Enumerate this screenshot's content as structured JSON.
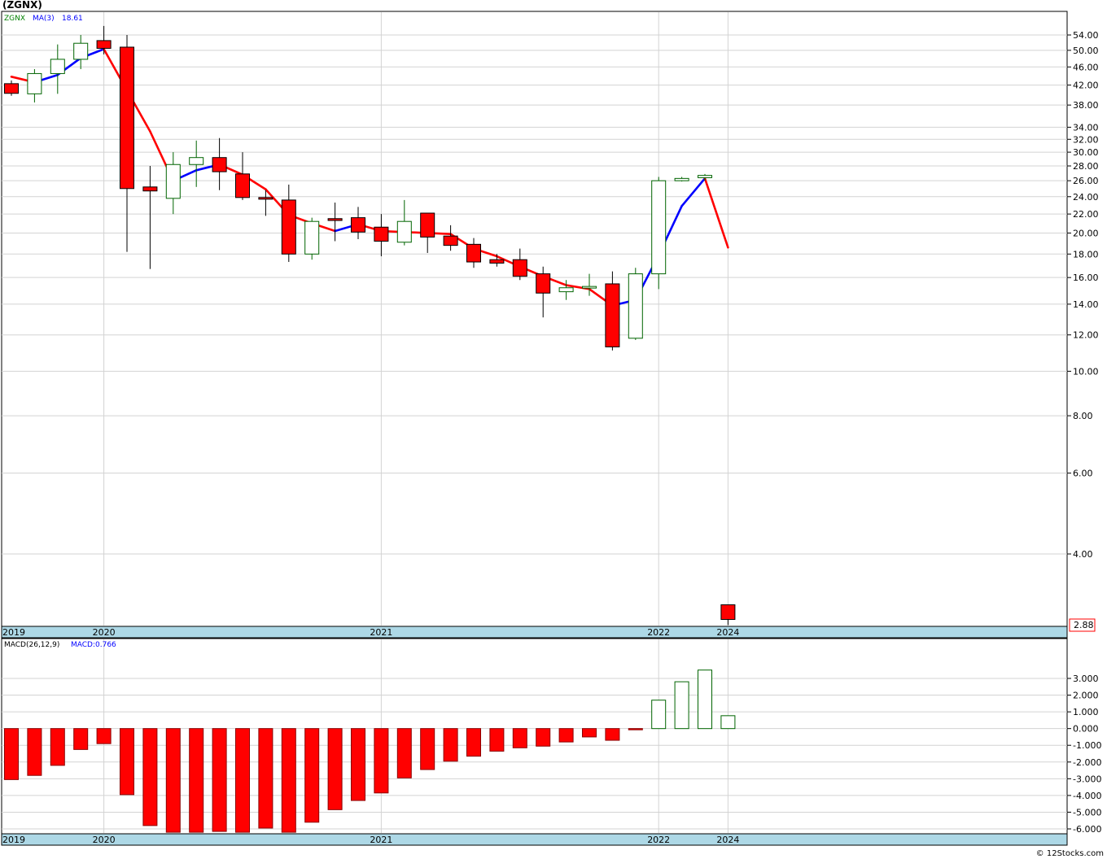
{
  "chart_data": [
    {
      "type": "candlestick",
      "title": "(ZGNX)",
      "legend": [
        {
          "text": "ZGNX",
          "color": "#008000"
        },
        {
          "text": "MA(3)",
          "color": "#0000ff"
        },
        {
          "text": "18.61",
          "color": "#0000ff"
        }
      ],
      "y_scale": "log",
      "y_ticks": [
        "54.00",
        "50.00",
        "46.00",
        "42.00",
        "38.00",
        "34.00",
        "32.00",
        "30.00",
        "28.00",
        "26.00",
        "24.00",
        "22.00",
        "20.00",
        "18.00",
        "16.00",
        "14.00",
        "12.00",
        "10.00",
        "8.00",
        "6.00",
        "4.00"
      ],
      "last_price": "2.88",
      "x_labels": [
        {
          "text": "2019",
          "index": -0.3
        },
        {
          "text": "2020",
          "index": 4
        },
        {
          "text": "2021",
          "index": 16
        },
        {
          "text": "2022",
          "index": 28
        },
        {
          "text": "2024",
          "index": 31
        }
      ],
      "candles": [
        {
          "o": 42.3,
          "h": 43.0,
          "l": 39.8,
          "c": 40.3
        },
        {
          "o": 40.2,
          "h": 45.5,
          "l": 38.5,
          "c": 44.5
        },
        {
          "o": 44.5,
          "h": 51.5,
          "l": 40.2,
          "c": 47.8
        },
        {
          "o": 47.8,
          "h": 54.0,
          "l": 45.5,
          "c": 51.8
        },
        {
          "o": 52.5,
          "h": 56.5,
          "l": 49.0,
          "c": 50.5
        },
        {
          "o": 50.8,
          "h": 54.0,
          "l": 18.2,
          "c": 25.0
        },
        {
          "o": 25.2,
          "h": 28.0,
          "l": 16.7,
          "c": 24.7
        },
        {
          "o": 23.8,
          "h": 30.0,
          "l": 22.0,
          "c": 28.2
        },
        {
          "o": 28.2,
          "h": 31.8,
          "l": 25.2,
          "c": 29.2
        },
        {
          "o": 29.2,
          "h": 32.2,
          "l": 24.8,
          "c": 27.2
        },
        {
          "o": 26.9,
          "h": 30.0,
          "l": 23.6,
          "c": 23.9
        },
        {
          "o": 23.9,
          "h": 24.8,
          "l": 21.8,
          "c": 23.7
        },
        {
          "o": 23.6,
          "h": 25.5,
          "l": 17.3,
          "c": 18.0
        },
        {
          "o": 18.0,
          "h": 21.6,
          "l": 17.5,
          "c": 21.2
        },
        {
          "o": 21.5,
          "h": 23.3,
          "l": 19.2,
          "c": 21.3
        },
        {
          "o": 21.6,
          "h": 22.8,
          "l": 19.4,
          "c": 20.1
        },
        {
          "o": 20.6,
          "h": 22.0,
          "l": 17.8,
          "c": 19.2
        },
        {
          "o": 19.1,
          "h": 23.6,
          "l": 18.8,
          "c": 21.2
        },
        {
          "o": 22.1,
          "h": 22.1,
          "l": 18.1,
          "c": 19.6
        },
        {
          "o": 19.7,
          "h": 20.8,
          "l": 18.3,
          "c": 18.8
        },
        {
          "o": 18.9,
          "h": 19.5,
          "l": 16.8,
          "c": 17.3
        },
        {
          "o": 17.5,
          "h": 18.0,
          "l": 16.9,
          "c": 17.2
        },
        {
          "o": 17.5,
          "h": 18.5,
          "l": 15.8,
          "c": 16.1
        },
        {
          "o": 16.3,
          "h": 16.9,
          "l": 13.1,
          "c": 14.8
        },
        {
          "o": 14.9,
          "h": 15.8,
          "l": 14.3,
          "c": 15.2
        },
        {
          "o": 15.2,
          "h": 16.3,
          "l": 14.6,
          "c": 15.3
        },
        {
          "o": 15.5,
          "h": 16.5,
          "l": 11.1,
          "c": 11.3
        },
        {
          "o": 11.8,
          "h": 16.8,
          "l": 11.7,
          "c": 16.3
        },
        {
          "o": 16.3,
          "h": 26.5,
          "l": 15.1,
          "c": 26.0
        },
        {
          "o": 26.0,
          "h": 26.5,
          "l": 25.9,
          "c": 26.3
        },
        {
          "o": 26.4,
          "h": 26.9,
          "l": 26.0,
          "c": 26.7
        },
        {
          "o": 3.1,
          "h": 3.1,
          "l": 2.8,
          "c": 2.88
        }
      ],
      "ma3": [
        43.8,
        42.6,
        44.2,
        48.1,
        50.3,
        40.9,
        33.3,
        26.0,
        27.4,
        28.2,
        26.8,
        24.9,
        21.9,
        21.0,
        20.2,
        20.9,
        20.2,
        20.1,
        20.0,
        19.9,
        18.5,
        17.8,
        16.9,
        16.1,
        15.4,
        15.1,
        13.9,
        14.3,
        17.9,
        22.9,
        26.3,
        18.6
      ],
      "ma3_colors": [
        "#ff0000",
        "#ff0000",
        "#0000ff",
        "#0000ff",
        "#0000ff",
        "#ff0000",
        "#ff0000",
        "#ff0000",
        "#0000ff",
        "#0000ff",
        "#ff0000",
        "#ff0000",
        "#ff0000",
        "#ff0000",
        "#ff0000",
        "#0000ff",
        "#ff0000",
        "#ff0000",
        "#ff0000",
        "#ff0000",
        "#ff0000",
        "#ff0000",
        "#ff0000",
        "#ff0000",
        "#ff0000",
        "#ff0000",
        "#ff0000",
        "#0000ff",
        "#0000ff",
        "#0000ff",
        "#0000ff",
        "#ff0000"
      ]
    },
    {
      "type": "bar",
      "title": "MACD(26,12,9)",
      "legend": [
        {
          "text": "MACD(26,12,9)",
          "color": "#000000"
        },
        {
          "text": "MACD:0.766",
          "color": "#0000ff"
        }
      ],
      "y_ticks": [
        "3.000",
        "2.000",
        "1.000",
        "0.000",
        "-1.000",
        "-2.000",
        "-3.000",
        "-4.000",
        "-5.000",
        "-6.000"
      ],
      "ylim": [
        -6.2,
        3.6
      ],
      "values": [
        -3.05,
        -2.8,
        -2.2,
        -1.25,
        -0.9,
        -3.95,
        -5.8,
        -6.25,
        -6.2,
        -6.15,
        -6.2,
        -5.95,
        -6.2,
        -5.6,
        -4.85,
        -4.3,
        -3.85,
        -2.95,
        -2.45,
        -1.95,
        -1.65,
        -1.35,
        -1.15,
        -1.05,
        -0.8,
        -0.5,
        -0.7,
        -0.05,
        1.7,
        2.8,
        3.5,
        0.77
      ],
      "x_labels": [
        {
          "text": "2019",
          "index": -0.3
        },
        {
          "text": "2020",
          "index": 4
        },
        {
          "text": "2021",
          "index": 16
        },
        {
          "text": "2022",
          "index": 28
        },
        {
          "text": "2024",
          "index": 31
        }
      ]
    }
  ],
  "copyright": "© 12Stocks.com"
}
